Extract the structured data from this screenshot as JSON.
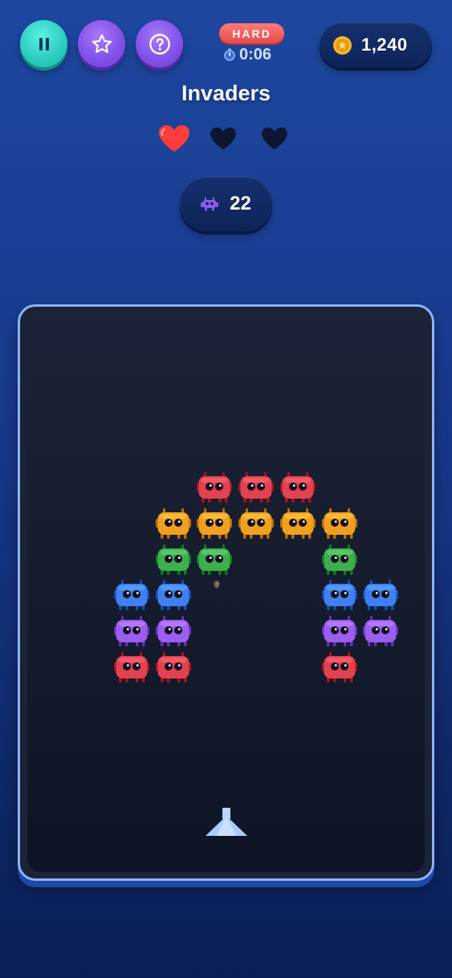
{
  "hud": {
    "buttons": [
      {
        "name": "pause",
        "icon": "pause-icon"
      },
      {
        "name": "favorite",
        "icon": "star-icon"
      },
      {
        "name": "help",
        "icon": "question-icon"
      }
    ],
    "difficulty": "HARD",
    "timer": "0:06",
    "timer_icon": "stopwatch-icon",
    "coins": "1,240",
    "coin_icon": "coin-star-icon"
  },
  "title": "Invaders",
  "lives": {
    "max": 3,
    "remaining": 1,
    "filled_color": "#ff3b3b",
    "empty_color": "#0d1530"
  },
  "score": {
    "icon": "alien-icon",
    "value": "22"
  },
  "invader_colors": {
    "red": "#e0424f",
    "orange": "#f0a021",
    "green": "#3fae4e",
    "blue": "#3f7ff0",
    "purple": "#9a5ff0"
  },
  "invader_grid": {
    "columns": 7,
    "rows": [
      [
        null,
        null,
        "red",
        "red",
        "red",
        null,
        null
      ],
      [
        null,
        "orange",
        "orange",
        "orange",
        "orange",
        "orange",
        null
      ],
      [
        null,
        "green",
        "green",
        null,
        null,
        "green",
        null
      ],
      [
        "blue",
        "blue",
        null,
        null,
        null,
        "blue",
        "blue"
      ],
      [
        "purple",
        "purple",
        null,
        null,
        null,
        "purple",
        "purple"
      ],
      [
        "red",
        "red",
        null,
        null,
        null,
        "red",
        null
      ]
    ]
  },
  "player": {
    "icon": "player-ship-icon",
    "color": "#a9cdfa"
  }
}
